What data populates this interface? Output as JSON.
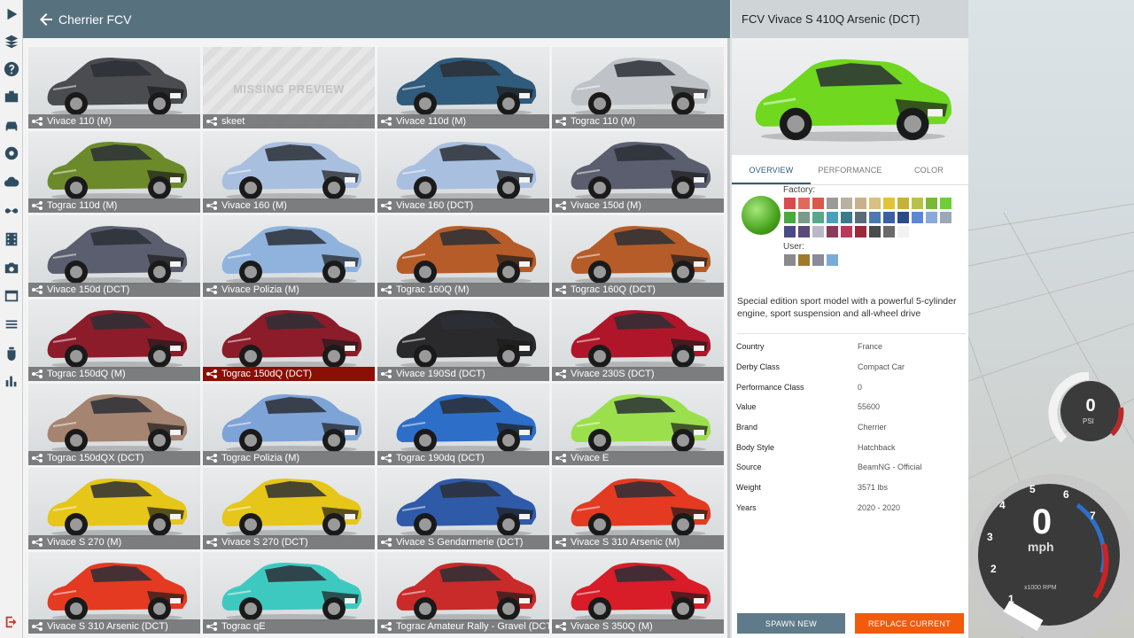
{
  "header": {
    "title": "Cherrier FCV"
  },
  "sidebar": {
    "icons": [
      "play-icon",
      "layers-icon",
      "help-icon",
      "mission-icon",
      "car-icon",
      "garage-icon",
      "cloud-icon",
      "infinity-icon",
      "film-icon",
      "camera-icon",
      "window-icon",
      "sliders-icon",
      "bug-icon",
      "bar-chart-icon"
    ],
    "bottom_label": "exit"
  },
  "grid": {
    "missing_preview_text": "MISSING PREVIEW",
    "tiles": [
      {
        "label": "Vivace 110 (M)",
        "color": "#4a4c50"
      },
      {
        "label": "skeet",
        "color": "",
        "missing": true
      },
      {
        "label": "Vivace 110d (M)",
        "color": "#2f5b7c"
      },
      {
        "label": "Tograc 110 (M)",
        "color": "#bfc3c8"
      },
      {
        "label": "Tograc 110d (M)",
        "color": "#6c8a2a"
      },
      {
        "label": "Vivace 160 (M)",
        "color": "#a9bfdf"
      },
      {
        "label": "Vivace 160 (DCT)",
        "color": "#a9bfdf"
      },
      {
        "label": "Vivace 150d (M)",
        "color": "#5a5e6e"
      },
      {
        "label": "Vivace 150d (DCT)",
        "color": "#5a5e6e"
      },
      {
        "label": "Vivace Polizia (M)",
        "color": "#8fb3dd"
      },
      {
        "label": "Tograc 160Q (M)",
        "color": "#b65c28"
      },
      {
        "label": "Tograc 160Q (DCT)",
        "color": "#b65c28"
      },
      {
        "label": "Tograc 150dQ (M)",
        "color": "#8c1c2a"
      },
      {
        "label": "Tograc 150dQ (DCT)",
        "color": "#8c1c2a",
        "selected": true
      },
      {
        "label": "Vivace 190Sd (DCT)",
        "color": "#2a2a2c"
      },
      {
        "label": "Vivace 230S (DCT)",
        "color": "#b0162a"
      },
      {
        "label": "Tograc 150dQX (DCT)",
        "color": "#a58472"
      },
      {
        "label": "Tograc Polizia (M)",
        "color": "#7ea3d6"
      },
      {
        "label": "Tograc 190dq (DCT)",
        "color": "#2d6ec8"
      },
      {
        "label": "Vivace E",
        "color": "#9be04c"
      },
      {
        "label": "Vivace S 270 (M)",
        "color": "#e6c618"
      },
      {
        "label": "Vivace S 270 (DCT)",
        "color": "#e6c618"
      },
      {
        "label": "Vivace S Gendarmerie (DCT)",
        "color": "#2f5aa8"
      },
      {
        "label": "Vivace S 310 Arsenic (M)",
        "color": "#e43a22"
      },
      {
        "label": "Vivace S 310 Arsenic (DCT)",
        "color": "#e43a22"
      },
      {
        "label": "Tograc qE",
        "color": "#3ec9c0"
      },
      {
        "label": "Tograc Amateur Rally - Gravel (DCT)",
        "color": "#c92a2a"
      },
      {
        "label": "Vivace S 350Q (M)",
        "color": "#d81c28"
      }
    ]
  },
  "panel": {
    "title": "FCV Vivace S 410Q Arsenic (DCT)",
    "preview_color": "#6fd81f",
    "tabs": [
      "OVERVIEW",
      "PERFORMANCE",
      "COLOR"
    ],
    "factory_label": "Factory:",
    "user_label": "User:",
    "factory_swatches": [
      "#d94a4a",
      "#e06a5a",
      "#d95a4a",
      "#9a9a9a",
      "#b8b0a0",
      "#c9b08a",
      "#d8c080",
      "#e2c23a",
      "#c6b23a",
      "#b8c24a",
      "#7ab83a",
      "#6ccf3a",
      "#4aa840",
      "#7a9a8a",
      "#5aa88a",
      "#4aa0b8",
      "#3a7a8a",
      "#5a6a78",
      "#4a7ab0",
      "#3a60a8",
      "#2a4a88",
      "#5a88d8",
      "#8aa8d8",
      "#9aa8b8",
      "#4a4a88",
      "#5a4a78",
      "#b8b8c8",
      "#8a3a5a",
      "#b83a5a",
      "#9a2a3a",
      "#4a4a4a",
      "#6a6a6a",
      "#f2f2f2"
    ],
    "user_swatches": [
      "#8a8a8a",
      "#a07a2a",
      "#8a8a9a",
      "#7aaad8"
    ],
    "description": "Special edition sport model with a powerful 5-cylinder engine, sport suspension and all-wheel drive",
    "info": [
      {
        "key": "Country",
        "value": "France"
      },
      {
        "key": "Derby Class",
        "value": "Compact Car"
      },
      {
        "key": "Performance Class",
        "value": "0"
      },
      {
        "key": "Value",
        "value": "55600"
      },
      {
        "key": "Brand",
        "value": "Cherrier"
      },
      {
        "key": "Body Style",
        "value": "Hatchback"
      },
      {
        "key": "Source",
        "value": "BeamNG - Official"
      },
      {
        "key": "Weight",
        "value": "3571 lbs"
      },
      {
        "key": "Years",
        "value": "2020 - 2020"
      }
    ],
    "spawn_label": "SPAWN NEW",
    "replace_label": "REPLACE CURRENT"
  },
  "hud": {
    "psi_value": "0",
    "psi_unit": "PSI",
    "speed_value": "0",
    "speed_unit": "mph",
    "rpm_label": "x1000 RPM",
    "rpm_ticks": [
      "1",
      "2",
      "3",
      "4",
      "5",
      "6",
      "7"
    ]
  }
}
